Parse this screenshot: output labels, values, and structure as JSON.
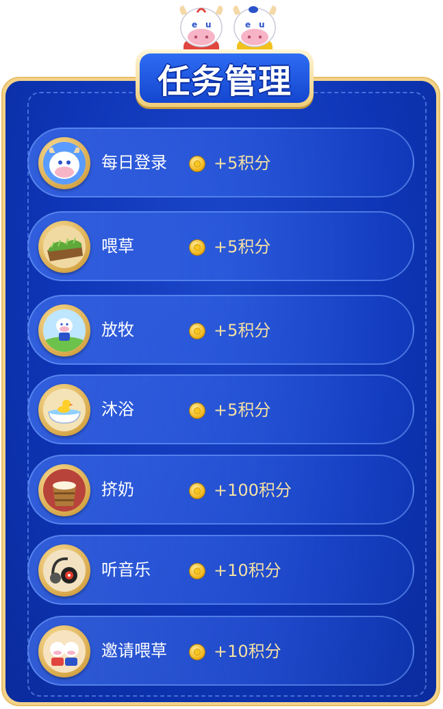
{
  "header": {
    "title": "任务管理"
  },
  "tasks": [
    {
      "name": "每日登录",
      "points": "+5积分",
      "icon": "cow-face-icon"
    },
    {
      "name": "喂草",
      "points": "+5积分",
      "icon": "grass-basket-icon"
    },
    {
      "name": "放牧",
      "points": "+5积分",
      "icon": "cow-pasture-icon"
    },
    {
      "name": "沐浴",
      "points": "+5积分",
      "icon": "duck-bathtub-icon"
    },
    {
      "name": "挤奶",
      "points": "+100积分",
      "icon": "milk-bucket-icon"
    },
    {
      "name": "听音乐",
      "points": "+10积分",
      "icon": "headphones-icon"
    },
    {
      "name": "邀请喂草",
      "points": "+10积分",
      "icon": "cow-friends-icon"
    }
  ],
  "colors": {
    "panel_blue": "#0e35b6",
    "frame_gold": "#f3d38a",
    "points_text": "#f6e1a4",
    "coin_gold": "#f2b415"
  }
}
